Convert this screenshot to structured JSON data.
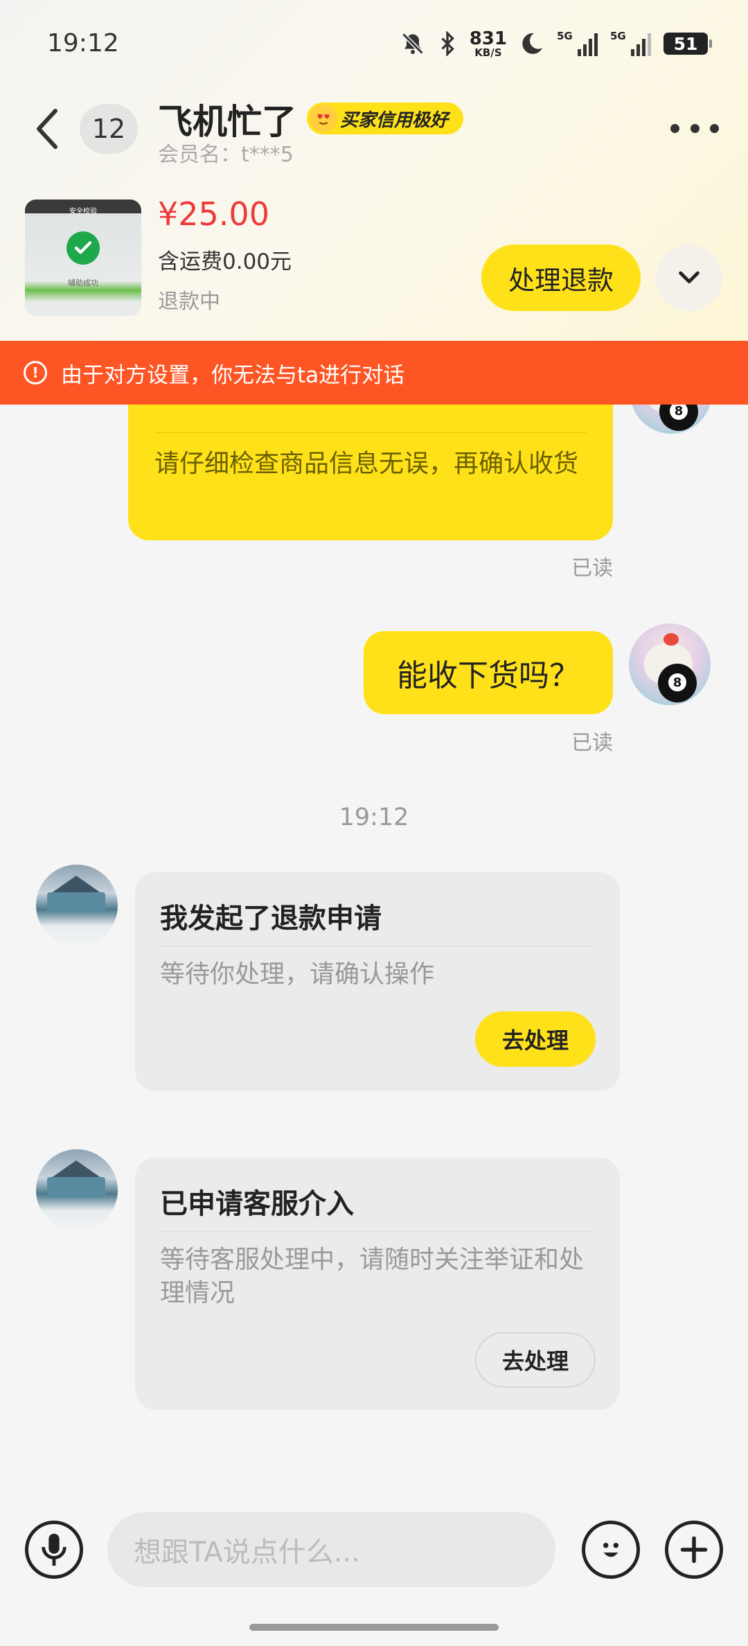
{
  "status_bar": {
    "time": "19:12",
    "net_speed_value": "831",
    "net_speed_unit": "KB/S",
    "signal1_label": "5G",
    "signal2_label": "5G",
    "battery": "51",
    "icons": [
      "mute-bell-icon",
      "bluetooth-icon",
      "moon-icon"
    ]
  },
  "header": {
    "unread_count": "12",
    "user_name": "飞机忙了",
    "credit_badge": "买家信用极好",
    "member_label": "会员名：t***5"
  },
  "product": {
    "price": "¥25.00",
    "shipping": "含运费0.00元",
    "status": "退款中",
    "thumb_top_text": "安全校验",
    "thumb_text": "辅助成功",
    "action_label": "处理退款"
  },
  "warning": {
    "text": "由于对方设置，你无法与ta进行对话"
  },
  "messages": {
    "msg1_desc": "请仔细检查商品信息无误，再确认收货",
    "msg1_read": "已读",
    "msg2_text": "能收下货吗？",
    "msg2_read": "已读",
    "time_sep": "19:12",
    "card1": {
      "title": "我发起了退款申请",
      "desc": "等待你处理，请确认操作",
      "button": "去处理"
    },
    "card2": {
      "title": "已申请客服介入",
      "desc": "等待客服处理中，请随时关注举证和处理情况",
      "button": "去处理"
    }
  },
  "input": {
    "placeholder": "想跟TA说点什么..."
  }
}
